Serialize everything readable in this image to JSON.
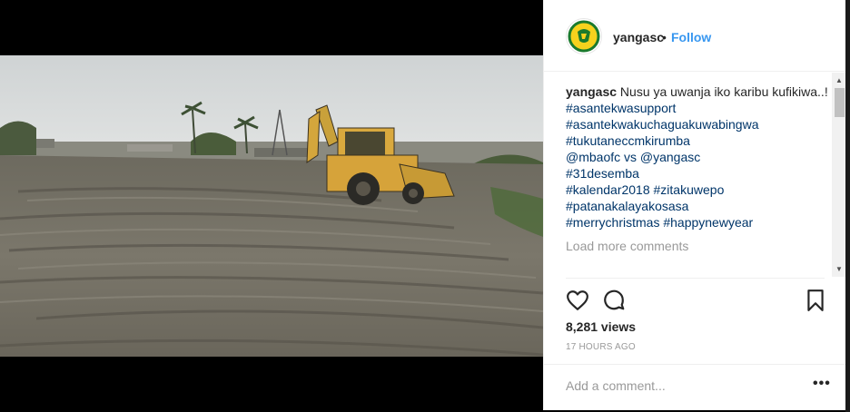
{
  "post": {
    "username": "yangasc",
    "separator": "•",
    "follow_label": "Follow",
    "avatar_icon": "club-crest-icon",
    "caption_text": " Nusu ya uwanja iko karibu kufikiwa..!",
    "hashtags": [
      "#asantekwasupport",
      "#asantekwakuchaguakuwabingwa",
      "#tukutaneccmkirumba",
      "@mbaofc vs @yangasc",
      "#31desemba",
      "#kalendar2018 #zitakuwepo",
      "#patanakalayakosasa",
      "#merrychristmas #happynewyear"
    ],
    "load_more_label": "Load more comments",
    "views": "8,281 views",
    "timestamp": "17 HOURS AGO",
    "comment_placeholder": "Add a comment...",
    "more_options": "•••"
  },
  "icons": {
    "like": "heart-icon",
    "comment": "comment-icon",
    "save": "bookmark-icon"
  },
  "colors": {
    "link": "#3897f0",
    "hashtag": "#003569",
    "text": "#262626",
    "muted": "#999999"
  }
}
